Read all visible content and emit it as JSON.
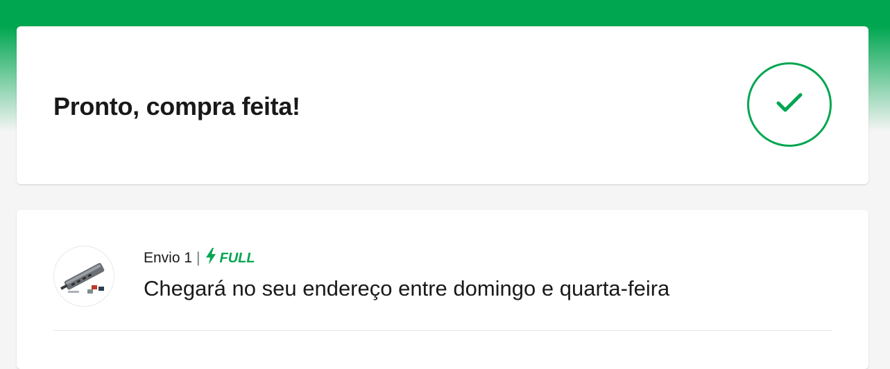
{
  "success": {
    "title": "Pronto, compra feita!",
    "icon": "check-icon",
    "accent_color": "#00a650"
  },
  "shipment": {
    "label": "Envio 1",
    "separator": "|",
    "badge": {
      "text": "FULL",
      "icon": "lightning-icon",
      "color": "#00a650"
    },
    "eta": "Chegará no seu endereço entre domingo e quarta-feira"
  }
}
